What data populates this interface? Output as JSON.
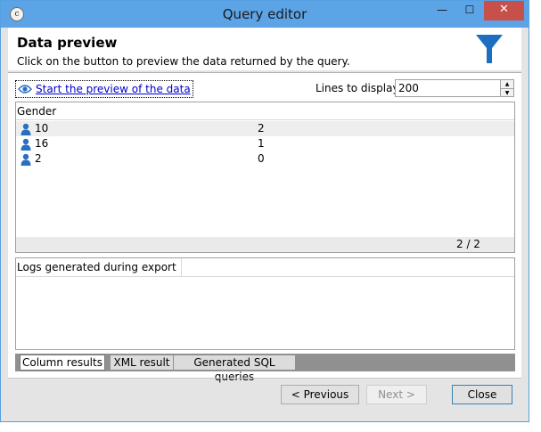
{
  "window": {
    "title": "Query editor",
    "controls": {
      "minimize": "—",
      "maximize": "☐",
      "close": "✕"
    }
  },
  "header": {
    "title": "Data preview",
    "subtitle": "Click on the button to preview the data returned by the query."
  },
  "toolbar": {
    "preview_link": "Start the preview of the data",
    "lines_label": "Lines to display:",
    "lines_value": "200"
  },
  "grid": {
    "column_header": "Gender",
    "rows": [
      {
        "c1": "10",
        "c2": "2"
      },
      {
        "c1": "16",
        "c2": "1"
      },
      {
        "c1": "2",
        "c2": "0"
      }
    ],
    "page_indicator": "2 / 2"
  },
  "logs": {
    "header": "Logs generated during export"
  },
  "tabs": [
    {
      "label": "Column results"
    },
    {
      "label": "XML result"
    },
    {
      "label": "Generated SQL queries"
    }
  ],
  "buttons": {
    "previous": "< Previous",
    "next": "Next >",
    "close": "Close"
  },
  "colors": {
    "titlebar": "#5ca4e5",
    "close_button": "#c7504b",
    "funnel": "#1c6fc0",
    "link": "#0000cc",
    "person_icon": "#2a6fbf"
  }
}
